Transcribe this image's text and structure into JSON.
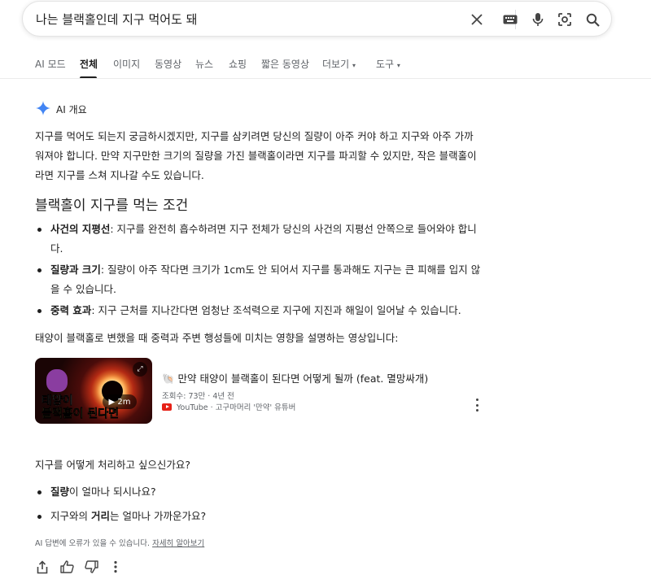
{
  "search": {
    "query": "나는 블랙홀인데 지구 먹어도 돼"
  },
  "tabs": [
    {
      "label": "AI 모드"
    },
    {
      "label": "전체"
    },
    {
      "label": "이미지"
    },
    {
      "label": "동영상"
    },
    {
      "label": "뉴스"
    },
    {
      "label": "쇼핑"
    },
    {
      "label": "짧은 동영상"
    },
    {
      "label": "더보기"
    },
    {
      "label": "도구"
    }
  ],
  "active_tab": "전체",
  "ai_overview": {
    "label": "AI 개요",
    "intro_line1": "지구를 먹어도 되는지 궁금하시겠지만, 지구를 삼키려면 당신의 질량이 아주 커야 하고 지구와 아주 가까",
    "intro_line2": "워져야 합니다. 만약 지구만한 크기의 질량을 가진 블랙홀이라면 지구를 파괴할 수 있지만, 작은 블랙홀이",
    "intro_line3": "라면 지구를 스쳐 지나갈 수도 있습니다.",
    "section_heading": "블랙홀이 지구를 먹는 조건",
    "bullets": [
      {
        "bold": "사건의 지평선",
        "line1": ": 지구를 완전히 흡수하려면 지구 전체가 당신의 사건의 지평선 안쪽으로 들어와야 합니",
        "line2": "다."
      },
      {
        "bold": "질량과 크기",
        "line1": ": 질량이 아주 작다면 크기가 1cm도 안 되어서 지구를 통과해도 지구는 큰 피해를 입지 않",
        "line2": "을 수 있습니다."
      },
      {
        "bold": "중력 효과",
        "line1": ": 지구 근처를 지나간다면 엄청난 조석력으로 지구에 지진과 해일이 일어날 수 있습니다.",
        "line2": ""
      }
    ],
    "video_intro": "태양이 블랙홀로 변했을 때 중력과 주변 행성들에 미치는 영향을 설명하는 영상입니다:",
    "video": {
      "thumb_line1": "태양이",
      "thumb_line2": "블랙홀이 된다면",
      "duration": "▶ 2m",
      "title": "🐚 만약 태양이 블랙홀이 된다면 어떻게 될까 (feat. 멸망싸개)",
      "views": "조회수: 73만 · 4년 전",
      "source": "YouTube · 고구마머리 '만약' 유튜버"
    },
    "question": "지구를 어떻게 처리하고 싶으신가요?",
    "questions": [
      {
        "pre": "",
        "bold": "질량",
        "post": "이 얼마나 되시나요?"
      },
      {
        "pre": "지구와의 ",
        "bold": "거리",
        "post": "는 얼마나 가까운가요?"
      }
    ],
    "disclaimer": "AI 답변에 오류가 있을 수 있습니다.",
    "disclaimer_link": "자세히 알아보기"
  },
  "colors": {
    "accent_blue": "#4285f4",
    "youtube_red": "#e62117",
    "text": "#1f1f1f",
    "muted": "#5f6368"
  }
}
